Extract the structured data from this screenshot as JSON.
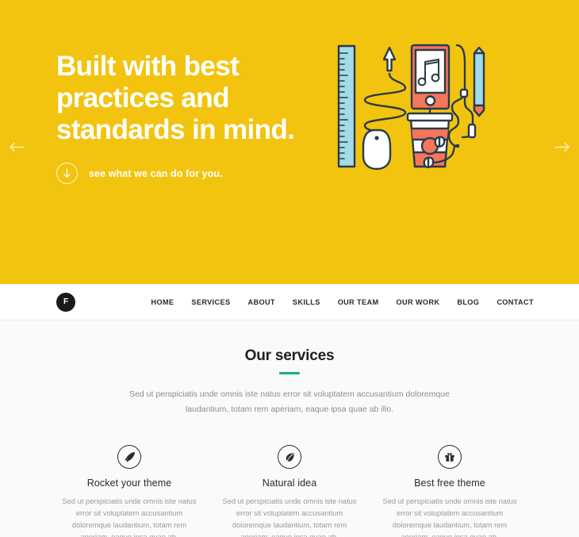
{
  "hero": {
    "title": "Built with best\npractices and\nstandards in mind.",
    "subtext": "see what we can do for you.",
    "down_icon": "arrow-down-icon",
    "prev_icon": "arrow-left-icon",
    "next_icon": "arrow-right-icon",
    "bg_color": "#f2c40f",
    "text_color": "#ffffff"
  },
  "illustration": {
    "name": "desk-tools-illustration",
    "items": [
      "ruler",
      "cable",
      "up-arrow",
      "computer-mouse",
      "smartphone-music",
      "coffee-cup",
      "pencil",
      "earbuds"
    ],
    "colors": {
      "outline": "#2b3a4a",
      "coral": "#f4765b",
      "light_blue": "#a3dbe8",
      "white": "#ffffff",
      "yellow": "#f2c40f"
    }
  },
  "navbar": {
    "logo_letter": "F",
    "logo_name": "site-logo",
    "items": [
      {
        "label": "HOME"
      },
      {
        "label": "SERVICES"
      },
      {
        "label": "ABOUT"
      },
      {
        "label": "SKILLS"
      },
      {
        "label": "OUR TEAM"
      },
      {
        "label": "OUR WORK"
      },
      {
        "label": "BLOG"
      },
      {
        "label": "CONTACT"
      }
    ]
  },
  "services": {
    "title": "Our services",
    "accent_color": "#1aab8a",
    "lead": "Sed ut perspiciatis unde omnis iste natus error sit voluptatem accusantium doloremque laudantium, totam rem aperiam, eaque ipsa quae ab illo.",
    "cards": [
      {
        "icon": "rocket-icon",
        "title": "Rocket your theme",
        "body": "Sed ut perspiciatis unde omnis iste natus error sit voluptatem accusantium doloremque laudantium, totam rem aperiam, eaque ipsa quae ab."
      },
      {
        "icon": "leaf-icon",
        "title": "Natural idea",
        "body": "Sed ut perspiciatis unde omnis iste natus error sit voluptatem accusantium doloremque laudantium, totam rem aperiam, eaque ipsa quae ab."
      },
      {
        "icon": "gift-icon",
        "title": "Best free theme",
        "body": "Sed ut perspiciatis unde omnis iste natus error sit voluptatem accusantium doloremque laudantium, totam rem aperiam, eaque ipsa quae ab."
      }
    ]
  }
}
